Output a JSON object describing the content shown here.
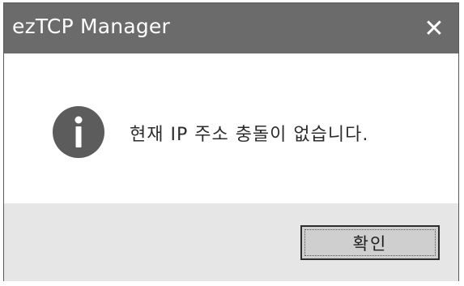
{
  "window": {
    "title": "ezTCP Manager",
    "close_symbol": "✕"
  },
  "dialog": {
    "icon": "info-icon",
    "message": "현재 IP 주소 충돌이 없습니다.",
    "ok_label": "확인"
  },
  "colors": {
    "titlebar": "#6b6b6b",
    "footer": "#e6e6e6",
    "icon": "#5c5c5c",
    "button": "#cfcfcf"
  }
}
